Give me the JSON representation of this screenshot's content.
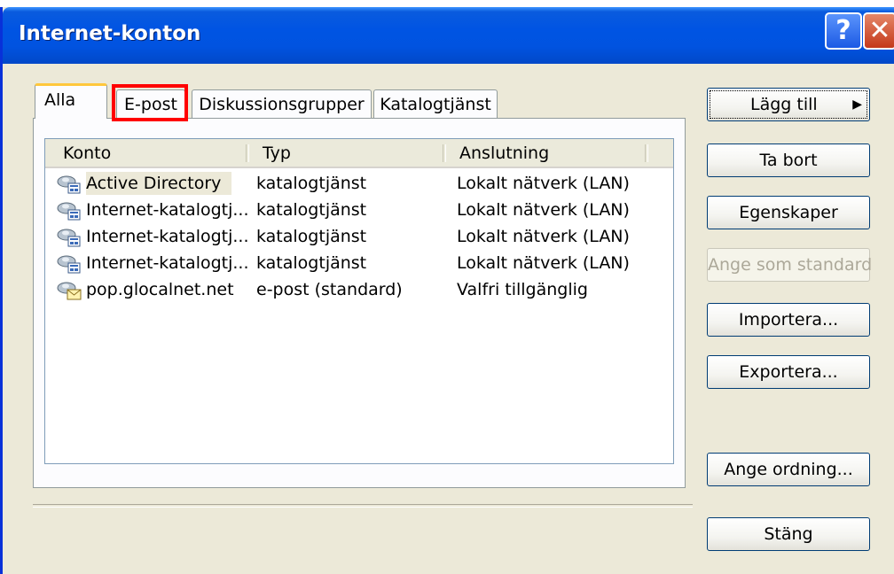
{
  "window": {
    "title": "Internet-konton",
    "help_glyph": "?",
    "close_glyph": "✕"
  },
  "tabs": [
    {
      "label": "Alla",
      "selected": true
    },
    {
      "label": "E-post",
      "selected": false,
      "highlighted": true
    },
    {
      "label": "Diskussionsgrupper",
      "selected": false
    },
    {
      "label": "Katalogtjänst",
      "selected": false
    }
  ],
  "list": {
    "columns": [
      "Konto",
      "Typ",
      "Anslutning"
    ],
    "rows": [
      {
        "name": "Active Directory",
        "type": "katalogtjänst",
        "connection": "Lokalt nätverk (LAN)",
        "icon": "directory-service-icon"
      },
      {
        "name": "Internet-katalogtj...",
        "type": "katalogtjänst",
        "connection": "Lokalt nätverk (LAN)",
        "icon": "directory-service-icon"
      },
      {
        "name": "Internet-katalogtj...",
        "type": "katalogtjänst",
        "connection": "Lokalt nätverk (LAN)",
        "icon": "directory-service-icon"
      },
      {
        "name": "Internet-katalogtj...",
        "type": "katalogtjänst",
        "connection": "Lokalt nätverk (LAN)",
        "icon": "directory-service-icon"
      },
      {
        "name": "pop.glocalnet.net",
        "type": "e-post (standard)",
        "connection": "Valfri tillgänglig",
        "icon": "mail-account-icon"
      }
    ]
  },
  "buttons": {
    "add": "Lägg till",
    "add_arrow": "▶",
    "remove": "Ta bort",
    "properties": "Egenskaper",
    "set_default": "Ange som standard",
    "import": "Importera...",
    "export": "Exportera...",
    "order": "Ange ordning...",
    "close": "Stäng"
  },
  "colors": {
    "titlebar": "#0054e3",
    "highlight": "#ff0000",
    "selected_tab_accent": "#ffc73c"
  }
}
